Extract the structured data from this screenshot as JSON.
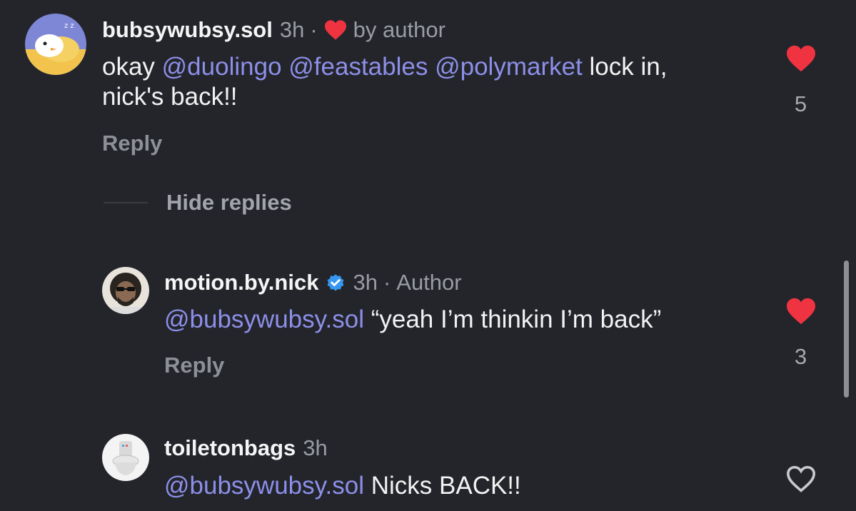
{
  "comments": [
    {
      "username": "bubsywubsy.sol",
      "time": "3h",
      "liked_by": "by author",
      "text_parts": [
        {
          "text": "okay ",
          "mention": false
        },
        {
          "text": "@duolingo",
          "mention": true
        },
        {
          "text": " ",
          "mention": false
        },
        {
          "text": "@feastables",
          "mention": true
        },
        {
          "text": " ",
          "mention": false
        },
        {
          "text": "@polymarket",
          "mention": true
        },
        {
          "text": " lock in,",
          "mention": false
        }
      ],
      "text_line2": "nick's back!!",
      "reply_label": "Reply",
      "likes": "5",
      "liked": true
    },
    {
      "username": "motion.by.nick",
      "time": "3h",
      "role": "Author",
      "mention": "@bubsywubsy.sol",
      "text": " “yeah I’m thinkin  I’m back”",
      "reply_label": "Reply",
      "likes": "3",
      "liked": true
    },
    {
      "username": "toiletonbags",
      "time": "3h",
      "mention": "@bubsywubsy.sol",
      "text": " Nicks BACK!!",
      "liked": false
    }
  ],
  "hide_replies_label": "Hide replies",
  "colors": {
    "background": "#23252b",
    "mention": "#8d8fe8",
    "heart": "#ef3340",
    "verified": "#3797f0",
    "muted": "#9a9ca3"
  },
  "icons": {
    "like": "heart-icon",
    "verified": "verified-badge-icon"
  }
}
